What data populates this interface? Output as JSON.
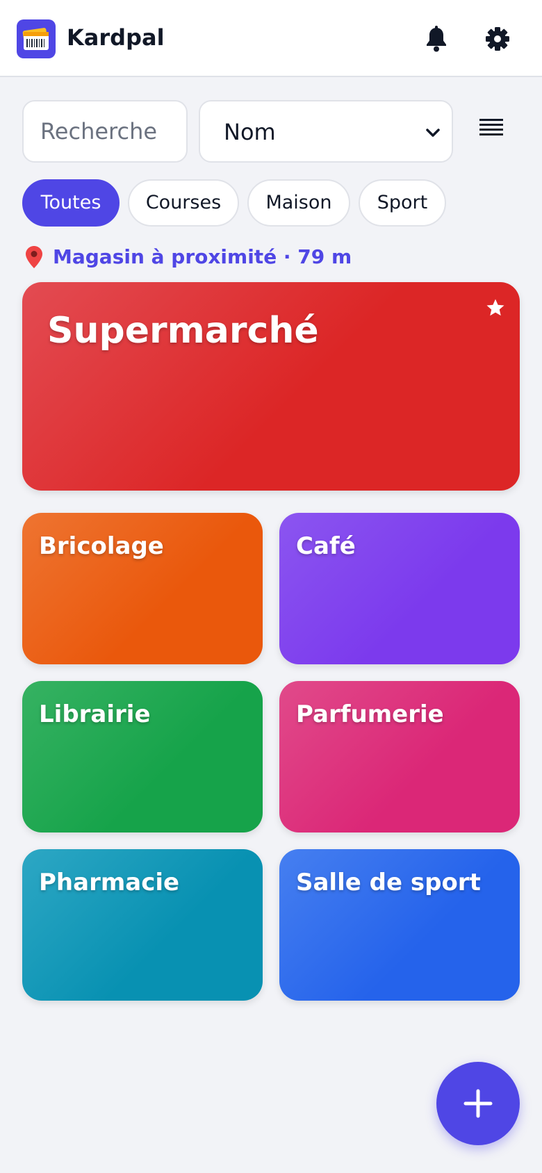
{
  "app": {
    "title": "Kardpal",
    "accent_color": "#4f46e5"
  },
  "header": {
    "icons": [
      "app-logo-icon",
      "bell-icon",
      "gear-icon"
    ]
  },
  "search": {
    "placeholder": "Recherche",
    "value": ""
  },
  "sort": {
    "selected": "Nom"
  },
  "filters": [
    {
      "label": "Toutes",
      "active": true
    },
    {
      "label": "Courses",
      "active": false
    },
    {
      "label": "Maison",
      "active": false
    },
    {
      "label": "Sport",
      "active": false
    }
  ],
  "nearby": {
    "text": "Magasin à proximité · 79 m"
  },
  "featured_card": {
    "name": "Supermarché",
    "favorite": true,
    "color": "#dc2626"
  },
  "cards": [
    {
      "name": "Bricolage",
      "color": "#ea580c"
    },
    {
      "name": "Café",
      "color": "#7c3aed"
    },
    {
      "name": "Librairie",
      "color": "#16a34a"
    },
    {
      "name": "Parfumerie",
      "color": "#db2777"
    },
    {
      "name": "Pharmacie",
      "color": "#0891b2"
    },
    {
      "name": "Salle de sport",
      "color": "#2563eb"
    }
  ],
  "fab": {
    "icon": "plus-icon"
  }
}
